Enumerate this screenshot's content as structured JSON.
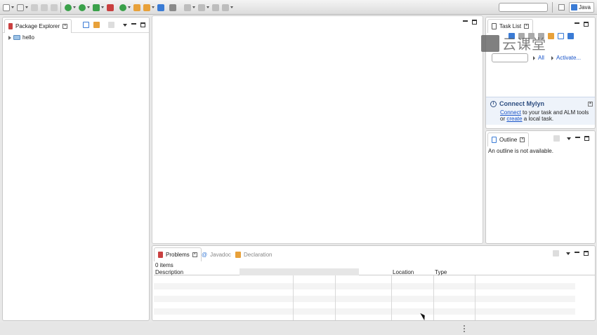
{
  "toolbar": {
    "search_value": "",
    "perspective_label": "Java",
    "colors": {
      "green": "#3aa14a",
      "orange": "#e8a13a",
      "blue": "#3a7bd5",
      "red": "#c94040",
      "gray": "#bdbdbd"
    }
  },
  "package_explorer": {
    "tab_label": "Package Explorer",
    "tree": [
      {
        "label": "hello",
        "icon": "project-folder-icon",
        "expanded": false
      }
    ]
  },
  "task_list": {
    "tab_label": "Task List",
    "filter_placeholder": "",
    "filter_all": "All",
    "activate": "Activate..."
  },
  "mylyn": {
    "title": "Connect Mylyn",
    "connect_link": "Connect",
    "text_1": " to your task and ALM tools",
    "text_2_prefix": "or ",
    "create_link": "create",
    "text_2_suffix": " a local task."
  },
  "outline": {
    "tab_label": "Outline",
    "message": "An outline is not available."
  },
  "bottom": {
    "tabs": [
      {
        "label": "Problems",
        "active": true
      },
      {
        "label": "Javadoc",
        "active": false
      },
      {
        "label": "Declaration",
        "active": false
      }
    ],
    "items_count": "0 items",
    "columns": [
      "Description",
      "Location",
      "Type"
    ]
  },
  "watermark": {
    "text": "云课堂"
  }
}
